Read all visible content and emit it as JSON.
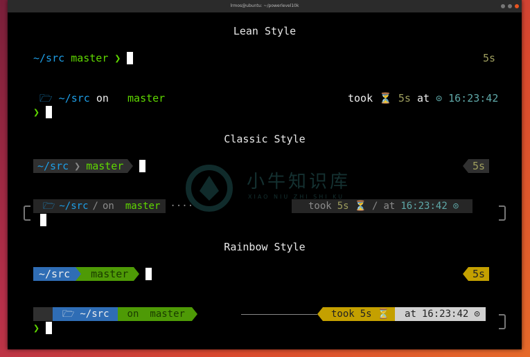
{
  "window": {
    "title": "lrmos@ubuntu: ~/powerlevel10k"
  },
  "lean": {
    "heading": "Lean Style",
    "line1": {
      "dir": "~/src",
      "branch": "master",
      "prompt": "❯",
      "right": "5s"
    },
    "line2": {
      "os": "",
      "folder": "🗁",
      "dir": "~/src",
      "on": "on",
      "git_icon": "",
      "branch_icon": "",
      "branch": "master",
      "took": "took",
      "hourglass": "⏳",
      "duration": "5s",
      "at": "at",
      "clock": "⊙",
      "time": "16:23:42"
    },
    "line3": {
      "prompt": "❯"
    }
  },
  "classic": {
    "heading": "Classic Style",
    "line1": {
      "dir": "~/src",
      "branch": "master",
      "right": "5s"
    },
    "line2": {
      "os": "",
      "folder": "🗁",
      "dir": "~/src",
      "sep": "/",
      "on": "on",
      "git_icon": "",
      "branch_icon": "",
      "branch": "master",
      "dots": "····",
      "took": "took",
      "duration": "5s",
      "hourglass": "⏳",
      "sep2": "/",
      "at": "at",
      "time": "16:23:42",
      "clock": "⊙"
    }
  },
  "rainbow": {
    "heading": "Rainbow Style",
    "line1": {
      "dir": "~/src",
      "branch": "master",
      "right": "5s"
    },
    "line2": {
      "os": "",
      "folder": "🗁",
      "dir": "~/src",
      "on": "on",
      "git_icon": "",
      "branch_icon": "",
      "branch": "master",
      "took": "took",
      "duration": "5s",
      "hourglass": "⏳",
      "at": "at",
      "time": "16:23:42",
      "clock": "⊙"
    },
    "line3": {
      "prompt": "❯"
    }
  },
  "watermark": {
    "title": "小牛知识库",
    "subtitle": "XIAO NIU ZHI SHI KU"
  },
  "colors": {
    "blue": "#1e9ee6",
    "green": "#5fd700",
    "rainbow_blue": "#2f6db5",
    "rainbow_green": "#4e9a06",
    "rainbow_yellow": "#c4a000",
    "rainbow_gray": "#d0d0d0"
  }
}
